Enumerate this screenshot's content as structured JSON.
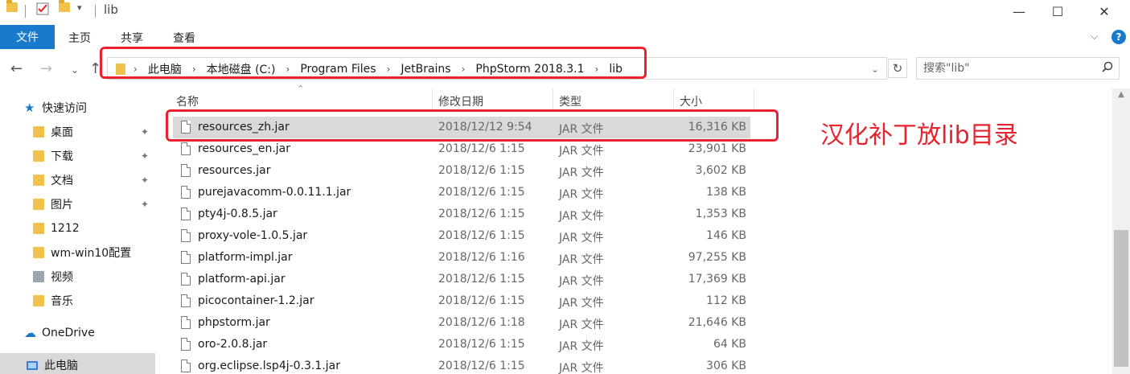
{
  "window": {
    "title": "lib",
    "minimize": "—",
    "maximize": "☐",
    "close": "✕"
  },
  "ribbon": {
    "file": "文件",
    "tabs": [
      "主页",
      "共享",
      "查看"
    ],
    "collapse": "⌵",
    "help": "?"
  },
  "nav": {
    "back": "←",
    "forward": "→",
    "recent": "⌄",
    "up": "↑"
  },
  "address": {
    "crumbs": [
      "此电脑",
      "本地磁盘 (C:)",
      "Program Files",
      "JetBrains",
      "PhpStorm 2018.3.1",
      "lib"
    ],
    "separator": "›",
    "dropdown": "⌄",
    "refresh": "↻"
  },
  "search": {
    "placeholder": "搜索\"lib\"",
    "icon": "search-icon"
  },
  "sidebar": {
    "items": [
      {
        "label": "快速访问",
        "icon": "star-icon"
      },
      {
        "label": "桌面",
        "icon": "folder-icon",
        "pinned": true
      },
      {
        "label": "下载",
        "icon": "download-folder-icon",
        "pinned": true
      },
      {
        "label": "文档",
        "icon": "documents-folder-icon",
        "pinned": true
      },
      {
        "label": "图片",
        "icon": "pictures-folder-icon",
        "pinned": true
      },
      {
        "label": "1212",
        "icon": "folder-icon"
      },
      {
        "label": "wm-win10配置",
        "icon": "folder-icon"
      },
      {
        "label": "视频",
        "icon": "videos-folder-icon"
      },
      {
        "label": "音乐",
        "icon": "music-folder-icon"
      },
      {
        "label": "OneDrive",
        "icon": "cloud-icon"
      },
      {
        "label": "此电脑",
        "icon": "computer-icon"
      }
    ],
    "pin_glyph": "📌"
  },
  "list": {
    "columns": [
      "名称",
      "修改日期",
      "类型",
      "大小"
    ],
    "sort_glyph": "⌃",
    "rows": [
      {
        "name": "resources_zh.jar",
        "date": "2018/12/12 9:54",
        "type": "JAR 文件",
        "size": "16,316 KB",
        "selected": true
      },
      {
        "name": "resources_en.jar",
        "date": "2018/12/6 1:15",
        "type": "JAR 文件",
        "size": "23,901 KB"
      },
      {
        "name": "resources.jar",
        "date": "2018/12/6 1:15",
        "type": "JAR 文件",
        "size": "3,602 KB"
      },
      {
        "name": "purejavacomm-0.0.11.1.jar",
        "date": "2018/12/6 1:15",
        "type": "JAR 文件",
        "size": "138 KB"
      },
      {
        "name": "pty4j-0.8.5.jar",
        "date": "2018/12/6 1:15",
        "type": "JAR 文件",
        "size": "1,353 KB"
      },
      {
        "name": "proxy-vole-1.0.5.jar",
        "date": "2018/12/6 1:15",
        "type": "JAR 文件",
        "size": "146 KB"
      },
      {
        "name": "platform-impl.jar",
        "date": "2018/12/6 1:16",
        "type": "JAR 文件",
        "size": "97,255 KB"
      },
      {
        "name": "platform-api.jar",
        "date": "2018/12/6 1:15",
        "type": "JAR 文件",
        "size": "17,369 KB"
      },
      {
        "name": "picocontainer-1.2.jar",
        "date": "2018/12/6 1:15",
        "type": "JAR 文件",
        "size": "112 KB"
      },
      {
        "name": "phpstorm.jar",
        "date": "2018/12/6 1:18",
        "type": "JAR 文件",
        "size": "21,646 KB"
      },
      {
        "name": "oro-2.0.8.jar",
        "date": "2018/12/6 1:15",
        "type": "JAR 文件",
        "size": "64 KB"
      },
      {
        "name": "org.eclipse.lsp4j-0.3.1.jar",
        "date": "2018/12/6 1:15",
        "type": "JAR 文件",
        "size": "306 KB"
      }
    ]
  },
  "annotation": {
    "text": "汉化补丁放lib目录",
    "color": "#e8232e"
  },
  "colors": {
    "accent": "#1979ca",
    "selection": "#d9d9d9",
    "annotation": "#e8232e"
  }
}
